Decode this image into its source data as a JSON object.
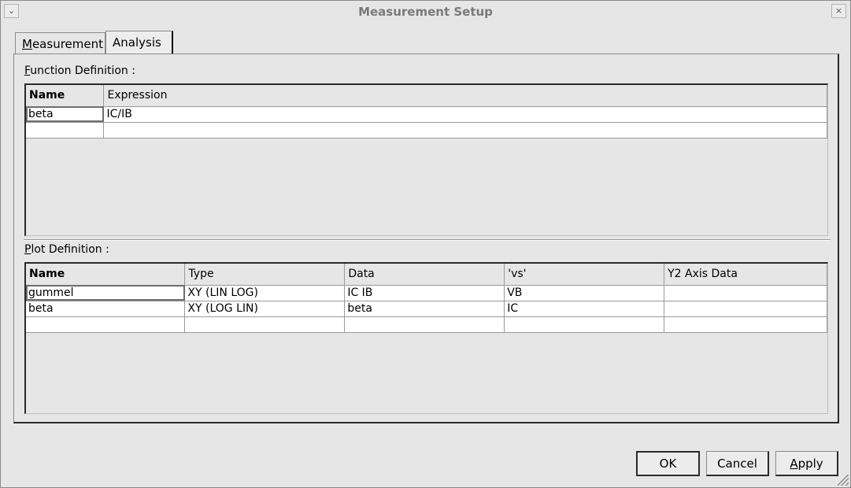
{
  "window": {
    "title": "Measurement Setup",
    "menu_glyph": "⌄",
    "close_glyph": "×"
  },
  "tabs": [
    {
      "label_first": "M",
      "label_rest": "easurement",
      "active": false
    },
    {
      "label_first": "Analysis",
      "label_rest": "",
      "active": true
    }
  ],
  "function_definition": {
    "label_first": "F",
    "label_rest": "unction Definition :",
    "columns": [
      "Name",
      "Expression"
    ],
    "rows": [
      [
        "beta",
        "IC/IB"
      ],
      [
        "",
        ""
      ]
    ]
  },
  "plot_definition": {
    "label_first": "P",
    "label_rest": "lot Definition :",
    "columns": [
      "Name",
      "Type",
      "Data",
      "'vs'",
      "Y2 Axis Data"
    ],
    "rows": [
      [
        "gummel",
        "XY (LIN LOG)",
        "IC IB",
        "VB",
        ""
      ],
      [
        "beta",
        "XY (LOG LIN)",
        "beta",
        "IC",
        ""
      ],
      [
        "",
        "",
        "",
        "",
        ""
      ]
    ]
  },
  "buttons": {
    "ok": "OK",
    "cancel": "Cancel",
    "apply_first": "A",
    "apply_rest": "pply"
  }
}
